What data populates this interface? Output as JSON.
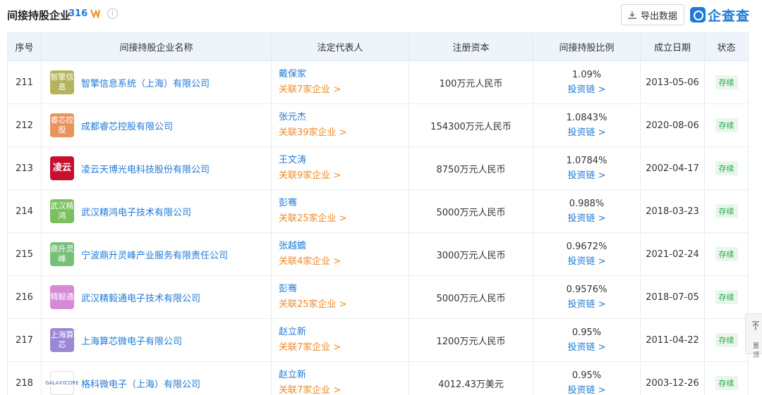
{
  "header": {
    "title": "间接持股企业",
    "count": "316",
    "export_label": "导出数据",
    "brand": "企查查"
  },
  "columns": [
    "序号",
    "间接持股企业名称",
    "法定代表人",
    "注册资本",
    "间接持股比例",
    "成立日期",
    "状态"
  ],
  "rows": [
    {
      "no": "211",
      "logo_text": "智擎信息",
      "logo_color": "#b5b35c",
      "name": "智擎信息系统（上海）有限公司",
      "rep": "戴保家",
      "rel": "关联7家企业 >",
      "capital": "100万元人民币",
      "ratio": "1.09%",
      "chain": "投资链 >",
      "date": "2013-05-06",
      "status": "存续"
    },
    {
      "no": "212",
      "logo_text": "睿芯控股",
      "logo_color": "#e8945c",
      "name": "成都睿芯控股有限公司",
      "rep": "张元杰",
      "rel": "关联39家企业 >",
      "capital": "154300万元人民币",
      "ratio": "1.0843%",
      "chain": "投资链 >",
      "date": "2020-08-06",
      "status": "存续"
    },
    {
      "no": "213",
      "logo_text": "凌云",
      "logo_color": "#c8102e",
      "name": "凌云天博光电科技股份有限公司",
      "rep": "王文涛",
      "rel": "关联9家企业 >",
      "capital": "8750万元人民币",
      "ratio": "1.0784%",
      "chain": "投资链 >",
      "date": "2002-04-17",
      "status": "存续"
    },
    {
      "no": "214",
      "logo_text": "武汉精鸿",
      "logo_color": "#7bbf5e",
      "name": "武汉精鸿电子技术有限公司",
      "rep": "彭骞",
      "rel": "关联25家企业 >",
      "capital": "5000万元人民币",
      "ratio": "0.988%",
      "chain": "投资链 >",
      "date": "2018-03-23",
      "status": "存续"
    },
    {
      "no": "215",
      "logo_text": "鼎升灵峰",
      "logo_color": "#76c07a",
      "name": "宁波鼎升灵峰产业服务有限责任公司",
      "rep": "张越蟾",
      "rel": "关联4家企业 >",
      "capital": "3000万元人民币",
      "ratio": "0.9672%",
      "chain": "投资链 >",
      "date": "2021-02-24",
      "status": "存续"
    },
    {
      "no": "216",
      "logo_text": "精毅通",
      "logo_color": "#d68ad6",
      "name": "武汉精毅通电子技术有限公司",
      "rep": "彭骞",
      "rel": "关联25家企业 >",
      "capital": "5000万元人民币",
      "ratio": "0.9576%",
      "chain": "投资链 >",
      "date": "2018-07-05",
      "status": "存续"
    },
    {
      "no": "217",
      "logo_text": "上海算芯",
      "logo_color": "#9b87d6",
      "name": "上海算芯微电子有限公司",
      "rep": "赵立新",
      "rel": "关联7家企业 >",
      "capital": "1200万元人民币",
      "ratio": "0.95%",
      "chain": "投资链 >",
      "date": "2011-04-22",
      "status": "存续"
    },
    {
      "no": "218",
      "logo_text": "GALAXYCORE",
      "logo_color": "#ffffff",
      "name": "格科微电子（上海）有限公司",
      "rep": "赵立新",
      "rel": "关联7家企业 >",
      "capital": "4012.43万美元",
      "ratio": "0.95%",
      "chain": "投资链 >",
      "date": "2003-12-26",
      "status": "存续"
    }
  ],
  "side_tab": {
    "label": "置顶"
  },
  "colors": {
    "accent": "#1f7ad6",
    "related": "#f08a24",
    "status_bg": "#e8f7ea",
    "status_fg": "#23a64d"
  }
}
